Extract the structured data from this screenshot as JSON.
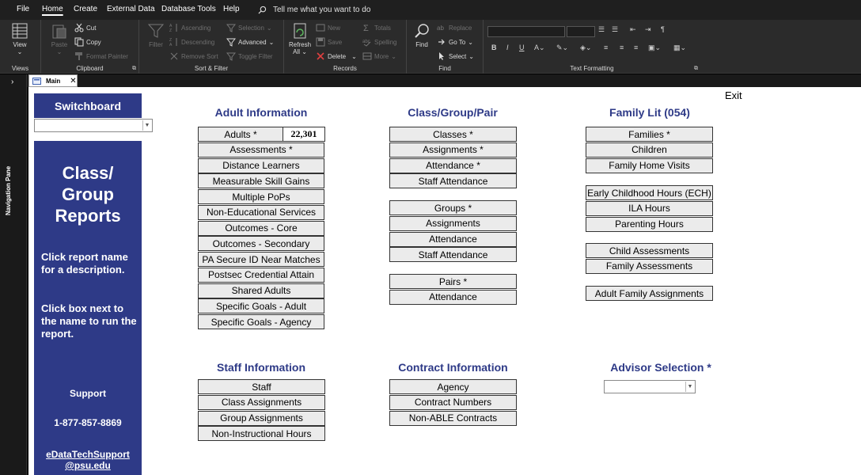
{
  "menu": {
    "tabs": [
      "File",
      "Home",
      "Create",
      "External Data",
      "Database Tools",
      "Help"
    ],
    "tell_me": "Tell me what you want to do"
  },
  "ribbon": {
    "views": {
      "view": "View",
      "label": "Views"
    },
    "clipboard": {
      "paste": "Paste",
      "cut": "Cut",
      "copy": "Copy",
      "format_painter": "Format Painter",
      "label": "Clipboard"
    },
    "sort_filter": {
      "filter": "Filter",
      "ascending": "Ascending",
      "descending": "Descending",
      "remove_sort": "Remove Sort",
      "selection": "Selection",
      "advanced": "Advanced",
      "toggle_filter": "Toggle Filter",
      "label": "Sort & Filter"
    },
    "records": {
      "refresh": "Refresh",
      "all": "All",
      "new": "New",
      "save": "Save",
      "delete": "Delete",
      "totals": "Totals",
      "spelling": "Spelling",
      "more": "More",
      "label": "Records"
    },
    "find": {
      "find": "Find",
      "replace": "Replace",
      "go_to": "Go To",
      "select": "Select",
      "label": "Find"
    },
    "text_formatting": {
      "bold": "B",
      "italic": "I",
      "underline": "U",
      "label": "Text Formatting"
    }
  },
  "nav_pane": {
    "label": "Navigation Pane"
  },
  "doc_tab": {
    "label": "Main"
  },
  "switchboard": {
    "title": "Switchboard",
    "side_title": "Class/ Group Reports",
    "instruction_1": "Click report name for a description.",
    "instruction_2": "Click box next to the name to run the report.",
    "support_label": "Support",
    "support_phone": "1-877-857-8869",
    "support_email": "eDataTechSupport @psu.edu"
  },
  "exit": "Exit",
  "adult_info": {
    "title": "Adult Information",
    "adults_count": "22,301",
    "items": [
      "Adults *",
      "Assessments *",
      "Distance Learners",
      "Measurable Skill Gains",
      "Multiple PoPs",
      "Non-Educational Services",
      "Outcomes - Core",
      "Outcomes - Secondary",
      "PA Secure ID Near Matches",
      "Postsec Credential Attain",
      "Shared Adults",
      "Specific Goals - Adult",
      "Specific Goals - Agency"
    ]
  },
  "class_group": {
    "title": "Class/Group/Pair",
    "classes": [
      "Classes *",
      "Assignments *",
      "Attendance *",
      "Staff Attendance"
    ],
    "groups": [
      "Groups *",
      "Assignments",
      "Attendance",
      "Staff Attendance"
    ],
    "pairs": [
      "Pairs *",
      "Attendance"
    ]
  },
  "family_lit": {
    "title": "Family Lit (054)",
    "families": [
      "Families *",
      "Children",
      "Family Home Visits"
    ],
    "hours": [
      "Early Childhood Hours (ECH)",
      "ILA Hours",
      "Parenting Hours"
    ],
    "assessments": [
      "Child Assessments",
      "Family Assessments"
    ],
    "assignments": [
      "Adult Family Assignments"
    ]
  },
  "staff_info": {
    "title": "Staff  Information",
    "items": [
      "Staff",
      "Class Assignments",
      "Group Assignments",
      "Non-Instructional Hours"
    ]
  },
  "contract_info": {
    "title": "Contract  Information",
    "items": [
      "Agency",
      "Contract Numbers",
      "Non-ABLE Contracts"
    ]
  },
  "advisor": {
    "title": "Advisor Selection *"
  },
  "colors": {
    "brand_blue": "#2e3a87",
    "button_bg": "#ebebeb",
    "ribbon_bg": "#2b2b2b"
  }
}
